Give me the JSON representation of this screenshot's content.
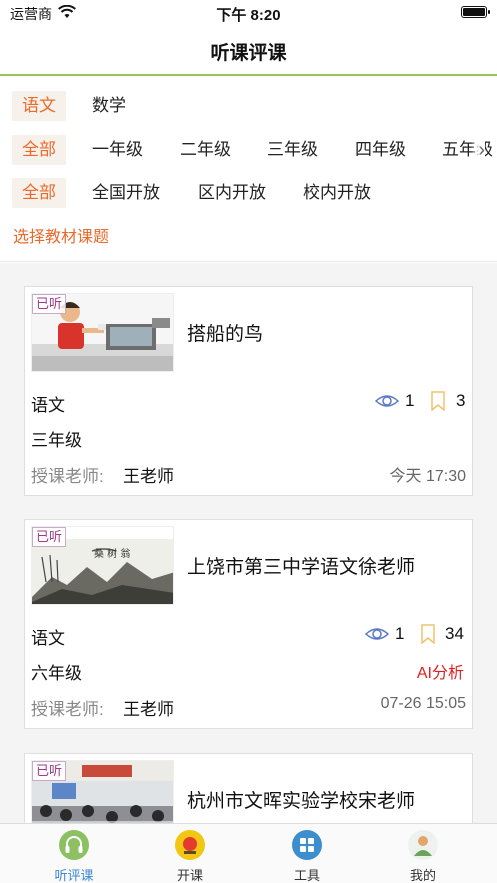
{
  "status_bar": {
    "carrier": "运营商",
    "time": "下午 8:20"
  },
  "nav": {
    "title": "听课评课"
  },
  "filters": {
    "subjects": [
      "语文",
      "数学"
    ],
    "grades": [
      "全部",
      "一年级",
      "二年级",
      "三年级",
      "四年级",
      "五年级"
    ],
    "scopes": [
      "全部",
      "全国开放",
      "区内开放",
      "校内开放"
    ],
    "choose_link": "选择教材课题"
  },
  "cards": [
    {
      "badge": "已听",
      "title": "搭船的鸟",
      "subject": "语文",
      "grade": "三年级",
      "views": "1",
      "bookmarks": "3",
      "teacher_label": "授课老师:",
      "teacher": "王老师",
      "time": "今天 17:30"
    },
    {
      "badge": "已听",
      "title": "上饶市第三中学语文徐老师",
      "subject": "语文",
      "grade": "六年级",
      "views": "1",
      "bookmarks": "34",
      "ai": "AI分析",
      "teacher_label": "授课老师:",
      "teacher": "王老师",
      "time": "07-26 15:05"
    },
    {
      "badge": "已听",
      "title": "杭州市文晖实验学校宋老师"
    }
  ],
  "tabs": [
    {
      "label": "听评课",
      "icon": "headphones-icon"
    },
    {
      "label": "开课",
      "icon": "record-icon"
    },
    {
      "label": "工具",
      "icon": "grid-icon"
    },
    {
      "label": "我的",
      "icon": "user-icon"
    }
  ],
  "colors": {
    "accent": "#ea6a2b",
    "active_tab": "#3a87d6",
    "nav_line": "#9ac34f"
  }
}
